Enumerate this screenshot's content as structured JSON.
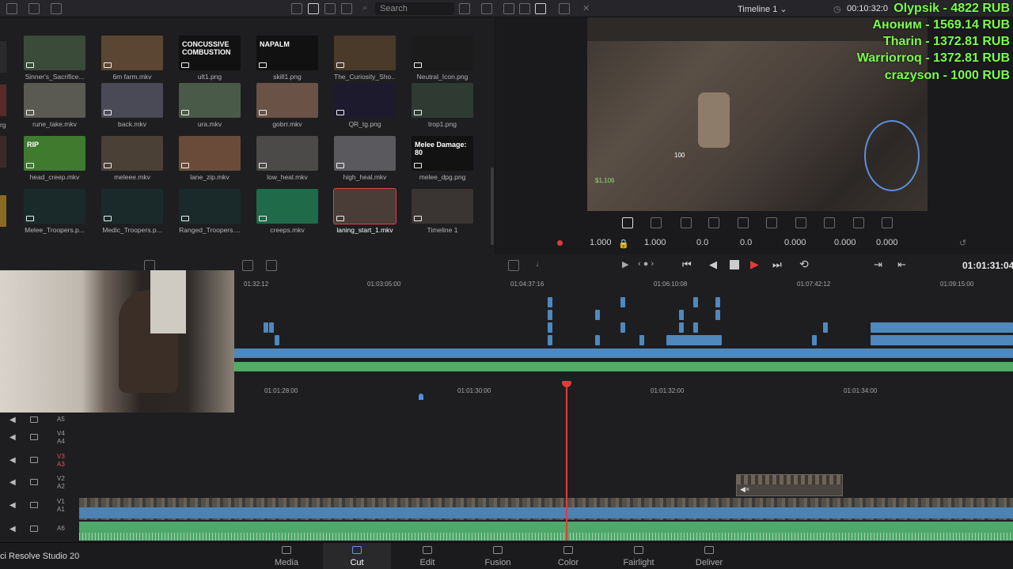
{
  "toolbar": {
    "search_placeholder": "Search",
    "timeline_name": "Timeline 1",
    "timecode": "00:10:32:0"
  },
  "media_pool": {
    "clips": [
      {
        "name": "Sinner's_Sacrifice...",
        "thumb": "#3a4b3a"
      },
      {
        "name": "6m farm.mkv",
        "thumb": "#5a4632"
      },
      {
        "name": "ult1.png",
        "thumb": "#111111",
        "overlay": "CONCUSSIVE COMBUSTION"
      },
      {
        "name": "skill1.png",
        "thumb": "#111111",
        "overlay": "NAPALM"
      },
      {
        "name": "The_Curiosity_Sho...",
        "thumb": "#4a3a2a"
      },
      {
        "name": "Neutral_Icon.png",
        "thumb": "#1b1b1b"
      },
      {
        "name": "rune_take.mkv",
        "thumb": "#5a5a52"
      },
      {
        "name": "back.mkv",
        "thumb": "#494a55"
      },
      {
        "name": "ura.mkv",
        "thumb": "#4a5a48"
      },
      {
        "name": "gobrr.mkv",
        "thumb": "#6a5247"
      },
      {
        "name": "QR_tg.png",
        "thumb": "#1d1a2e"
      },
      {
        "name": "trop1.png",
        "thumb": "#2f3a33"
      },
      {
        "name": "head_creep.mkv",
        "thumb": "#3f7a2f",
        "overlay": "RIP"
      },
      {
        "name": "meleee.mkv",
        "thumb": "#4a4036"
      },
      {
        "name": "lane_zip.mkv",
        "thumb": "#6a4b3a"
      },
      {
        "name": "low_heal.mkv",
        "thumb": "#4c4a48"
      },
      {
        "name": "high_heal.mkv",
        "thumb": "#5a5a5e"
      },
      {
        "name": "melee_dpg.png",
        "thumb": "#121212",
        "overlay": "Melee Damage: 80"
      },
      {
        "name": "Melee_Troopers.p...",
        "thumb": "#1a2a2a"
      },
      {
        "name": "Medic_Troopers.p...",
        "thumb": "#1a2a2a"
      },
      {
        "name": "Ranged_Troopers....",
        "thumb": "#1a2a2a"
      },
      {
        "name": "creeps.mkv",
        "thumb": "#1f6a48"
      },
      {
        "name": "laning_start_1.mkv",
        "thumb": "#4a3c36",
        "selected": true
      },
      {
        "name": "Timeline 1",
        "thumb": "#3a3433"
      }
    ],
    "left_labels": [
      "rg",
      "",
      ""
    ]
  },
  "viewer": {
    "donations": [
      "Olypsik - 4822 RUB",
      "Аноним - 1569.14 RUB",
      "Tharin - 1372.81 RUB",
      "Warriorroq - 1372.81 RUB",
      "crazyson - 1000 RUB"
    ],
    "hud_gold": "$1,106",
    "hud_damage": "100",
    "params": {
      "zoom_x": "1.000",
      "zoom_y": "1.000",
      "pos_x": "0.0",
      "pos_y": "0.0",
      "rotation": "0.000",
      "pitch": "0.000",
      "yaw": "0.000"
    }
  },
  "transport": {
    "timecode": "01:01:31:04"
  },
  "upper_ruler": [
    "01:32:12",
    "01:03:05:00",
    "01:04:37:16",
    "01:06:10:08",
    "01:07:42:12",
    "01:09:15:00"
  ],
  "lower_ruler": [
    "01:01:28:00",
    "01:01:30:00",
    "01:01:32:00",
    "01:01:34:00"
  ],
  "tracks": [
    {
      "v": "",
      "a": "A5"
    },
    {
      "v": "V4",
      "a": "A4"
    },
    {
      "v": "V3",
      "a": "A3"
    },
    {
      "v": "V2",
      "a": "A2"
    },
    {
      "v": "V1",
      "a": "A1"
    },
    {
      "v": "",
      "a": "A6"
    }
  ],
  "nav": {
    "items": [
      "Media",
      "Cut",
      "Edit",
      "Fusion",
      "Color",
      "Fairlight",
      "Deliver"
    ],
    "active": "Cut",
    "brand": "ci Resolve Studio 20"
  },
  "colors": {
    "accent": "#e23b3b",
    "video_track": "#4f88bd",
    "audio_track": "#4fae66",
    "donation": "#7cff4a"
  }
}
